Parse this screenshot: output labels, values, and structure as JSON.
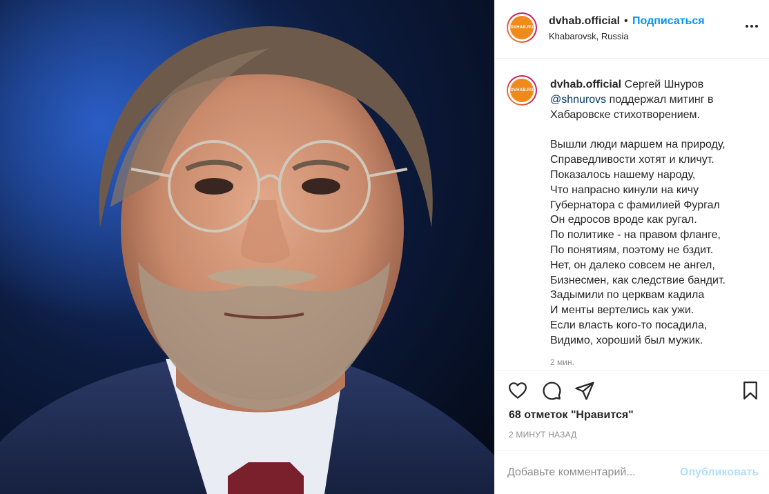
{
  "post": {
    "username": "dvhab.official",
    "avatar_logo_text": "DVHAB.RU",
    "separator": "•",
    "follow_label": "Подписаться",
    "location": "Khabarovsk, Russia",
    "more_icon": "more-horizontal-icon"
  },
  "caption": {
    "username": "dvhab.official",
    "text_before_mention": " Сергей Шнуров ",
    "mention": "@shnurovs",
    "text_after_mention": " поддержал митинг в Хабаровске стихотворением.",
    "poem_lines": [
      "Вышли люди маршем на природу,",
      "Справедливости хотят и кличут.",
      "Показалось нашему народу,",
      "Что напрасно кинули на кичу",
      "Губернатора с фамилией Фургал",
      "Он едросов вроде как ругал.",
      "По политике - на правом фланге,",
      "По понятиям, поэтому не бздит.",
      "Нет, он далеко совсем не ангел,",
      "Бизнесмен, как следствие бандит.",
      "Задымили по церквам кадила",
      "И менты вертелись как ужи.",
      "Если власть кого-то посадила,",
      "Видимо, хороший был мужик."
    ],
    "time": "2 мин."
  },
  "actions": {
    "like_icon": "heart-icon",
    "comment_icon": "comment-icon",
    "share_icon": "share-icon",
    "save_icon": "bookmark-icon"
  },
  "likes_text": "68 отметок \"Нравится\"",
  "post_date": "2 МИНУТ НАЗАД",
  "comment": {
    "placeholder": "Добавьте комментарий...",
    "publish_label": "Опубликовать"
  },
  "colors": {
    "accent": "#0095f6",
    "publish_disabled": "#b2dffc",
    "brand_orange": "#f08a1d"
  }
}
